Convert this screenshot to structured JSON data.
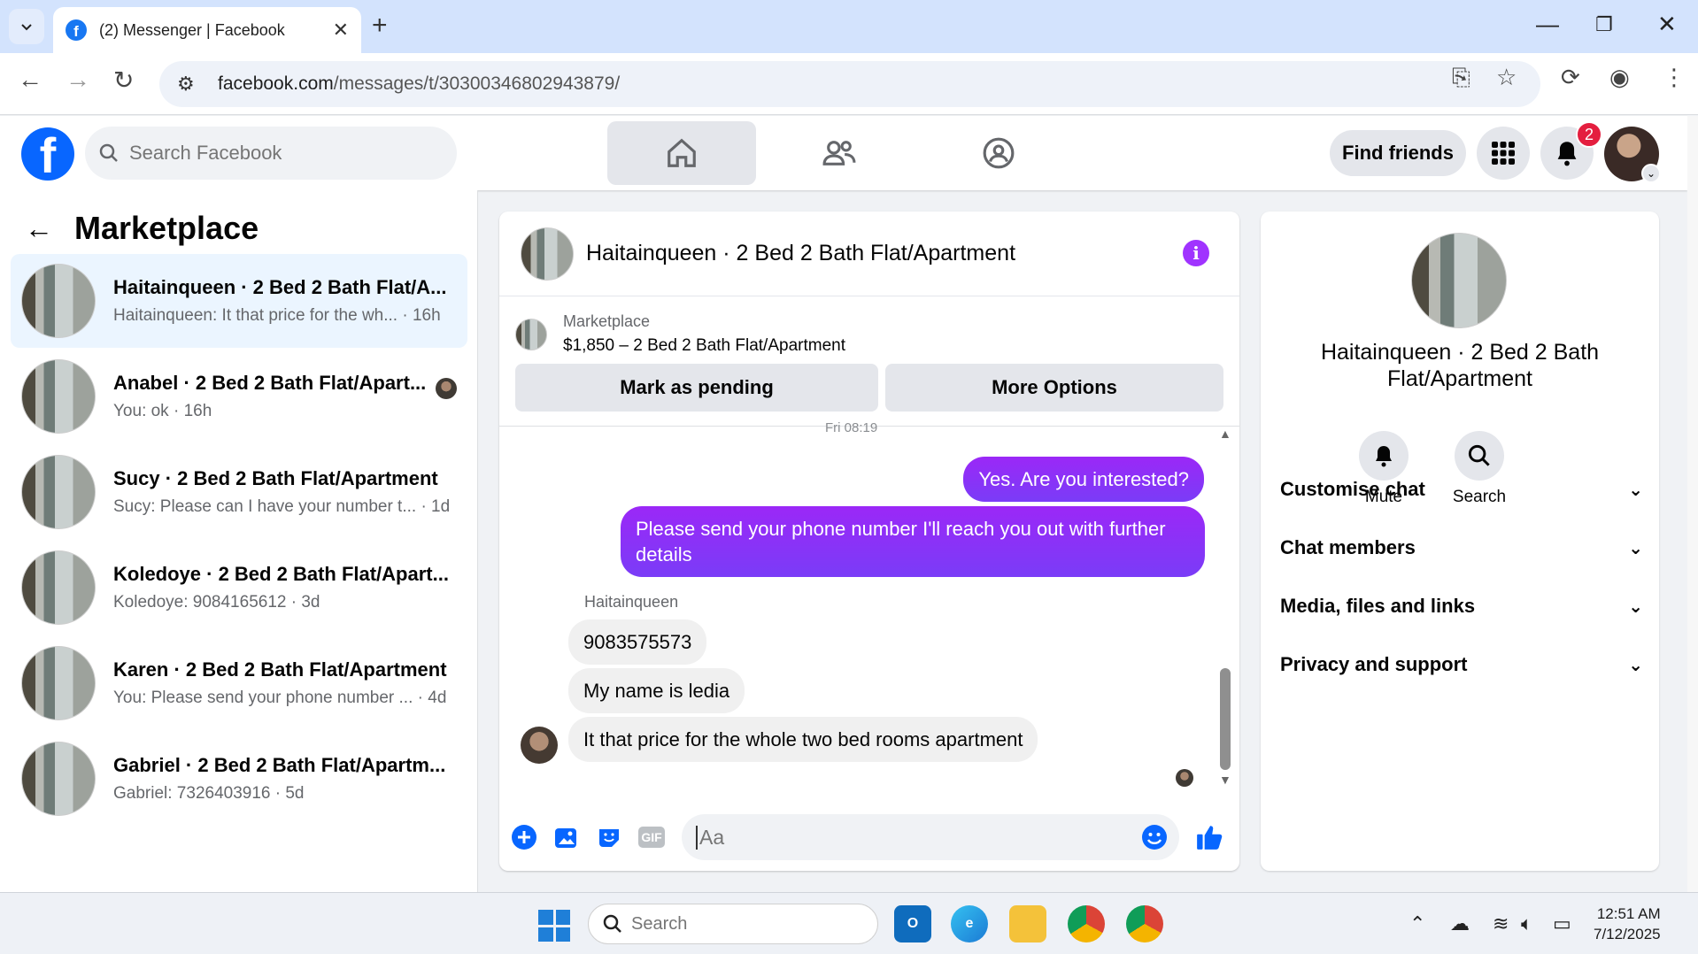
{
  "browser": {
    "tab_title": "(2) Messenger | Facebook",
    "url_domain": "facebook.com",
    "url_path": "/messages/t/30300346802943879/"
  },
  "fb": {
    "search_placeholder": "Search Facebook",
    "find_friends": "Find friends",
    "notification_count": "2"
  },
  "sidebar": {
    "title": "Marketplace",
    "conversations": [
      {
        "name": "Haitainqueen · 2 Bed 2 Bath Flat/A...",
        "last": "Haitainqueen: It that price for the wh... · 16h"
      },
      {
        "name": "Anabel · 2 Bed 2 Bath Flat/Apart...",
        "last": "You: ok · 16h"
      },
      {
        "name": "Sucy · 2 Bed 2 Bath Flat/Apartment",
        "last": "Sucy: Please can I have your number t... · 1d"
      },
      {
        "name": "Koledoye · 2 Bed 2 Bath Flat/Apart...",
        "last": "Koledoye: 9084165612 · 3d"
      },
      {
        "name": "Karen · 2 Bed 2 Bath Flat/Apartment",
        "last": "You: Please send your phone number ... · 4d"
      },
      {
        "name": "Gabriel · 2 Bed 2 Bath Flat/Apartm...",
        "last": "Gabriel: 7326403916 · 5d"
      }
    ]
  },
  "chat": {
    "title": "Haitainqueen · 2 Bed 2 Bath Flat/Apartment",
    "marketplace_label": "Marketplace",
    "listing": "$1,850 – 2 Bed 2 Bath Flat/Apartment",
    "mark_pending": "Mark as pending",
    "more_options": "More Options",
    "timestamp": "Fri 08:19",
    "messages_out": [
      "Yes. Are you interested?",
      "Please send your phone number  I'll reach you out with further details"
    ],
    "sender_name": "Haitainqueen",
    "messages_in": [
      "9083575573",
      "My name is ledia",
      "It that price for the whole two bed rooms apartment"
    ],
    "input_placeholder": "Aa",
    "gif_label": "GIF"
  },
  "info_panel": {
    "title": "Haitainqueen · 2 Bed 2 Bath Flat/Apartment",
    "mute": "Mute",
    "search": "Search",
    "sections": [
      "Customise chat",
      "Chat members",
      "Media, files and links",
      "Privacy and support"
    ]
  },
  "taskbar": {
    "search_placeholder": "Search",
    "time": "12:51 AM",
    "date": "7/12/2025"
  },
  "colors": {
    "fb_blue": "#0866ff",
    "messenger_purple": "#8a2cff",
    "notif_red": "#e41e3f"
  }
}
